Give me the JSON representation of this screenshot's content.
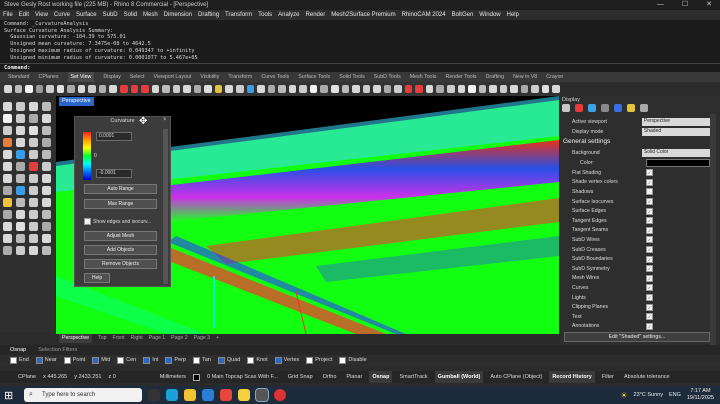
{
  "window": {
    "title": "Steve Gesly Rost working file (225 MB) - Rhino 8 Commercial - [Perspective]",
    "controls": [
      "—",
      "☐",
      "✕"
    ]
  },
  "menu": [
    "File",
    "Edit",
    "View",
    "Curve",
    "Surface",
    "SubD",
    "Solid",
    "Mesh",
    "Dimension",
    "Drafting",
    "Transform",
    "Tools",
    "Analyze",
    "Render",
    "Mesh2Surface Premium",
    "RhinoCAM 2024",
    "BoltGen",
    "Window",
    "Help"
  ],
  "command_history": [
    "Command: _CurvatureAnalysis",
    "Surface Curvature Analysis Summary:",
    "  Gaussian curvature: -104.39 to 575.01",
    "  Unsigned mean curvature: 7.3475e-08 to 4642.5",
    "  Unsigned maximum radius of curvature: 0.049347 to +infinity",
    "  Unsigned minimum radius of curvature: 0.0001077 to 5.467e+05"
  ],
  "command_prompt": "Command:",
  "toolbar_tabs": [
    "Standard",
    "CPlanes",
    "Set View",
    "Display",
    "Select",
    "Viewport Layout",
    "Visibility",
    "Transform",
    "Curve Tools",
    "Surface Tools",
    "Solid Tools",
    "SubD Tools",
    "Mesh Tools",
    "Render Tools",
    "Drafting",
    "New in V8",
    "Crayon"
  ],
  "toolbar_tab_active": "Set View",
  "viewport": {
    "label": "Perspective",
    "tabs": [
      "Perspective",
      "Top",
      "Front",
      "Right",
      "Page 1",
      "Page 2",
      "Page 3",
      "+"
    ],
    "active_tab": "Perspective"
  },
  "curvature_panel": {
    "title": "Curvature",
    "max_value": "0.0001",
    "mid_value": "0",
    "min_value": "-0.0001",
    "auto_range": "Auto Range",
    "max_range": "Max Range",
    "show_edges": "Show edges and isocurv...",
    "adjust_mesh": "Adjust Mesh",
    "add_objects": "Add Objects",
    "remove_objects": "Remove Objects",
    "help": "Help"
  },
  "display_panel": {
    "title": "Display",
    "active_viewport_label": "Active viewport",
    "active_viewport_value": "Perspective",
    "display_mode_label": "Display mode",
    "display_mode_value": "Shaded",
    "section": "General settings",
    "background_label": "Background",
    "background_value": "Solid Color",
    "color_label": "Color:",
    "options": [
      {
        "label": "Flat Shading",
        "checked": true
      },
      {
        "label": "Shade vertex colors",
        "checked": true
      },
      {
        "label": "Shadows",
        "checked": false
      },
      {
        "label": "Surface Isocurves",
        "checked": true
      },
      {
        "label": "Surface Edges",
        "checked": true
      },
      {
        "label": "Tangent Edges",
        "checked": true
      },
      {
        "label": "Tangent Seams",
        "checked": true
      },
      {
        "label": "SubD Wires",
        "checked": true
      },
      {
        "label": "SubD Creases",
        "checked": true
      },
      {
        "label": "SubD Boundaries",
        "checked": true
      },
      {
        "label": "SubD Symmetry",
        "checked": true
      },
      {
        "label": "Mesh Wires",
        "checked": true
      },
      {
        "label": "Curves",
        "checked": true
      },
      {
        "label": "Lights",
        "checked": true
      },
      {
        "label": "Clipping Planes",
        "checked": true
      },
      {
        "label": "Text",
        "checked": true
      },
      {
        "label": "Annotations",
        "checked": true
      }
    ],
    "edit_button": "Edit \"Shaded\" settings..."
  },
  "osnap": {
    "tabs": [
      "Osnap",
      "Selection Filters"
    ],
    "items": [
      {
        "label": "End",
        "on": false
      },
      {
        "label": "Near",
        "on": true
      },
      {
        "label": "Point",
        "on": false
      },
      {
        "label": "Mid",
        "on": true
      },
      {
        "label": "Cen",
        "on": false
      },
      {
        "label": "Int",
        "on": true
      },
      {
        "label": "Perp",
        "on": true
      },
      {
        "label": "Tan",
        "on": false
      },
      {
        "label": "Quad",
        "on": true
      },
      {
        "label": "Knot",
        "on": false
      },
      {
        "label": "Vertex",
        "on": true
      },
      {
        "label": "Project",
        "on": false
      },
      {
        "label": "Disable",
        "on": false
      }
    ]
  },
  "status": {
    "cplane": "CPlane",
    "x": "x 445.265",
    "y": "y 2433.251",
    "z": "z 0",
    "units": "Millimeters",
    "layer": "0 Main Topcap Scas With F...",
    "buttons": [
      "Grid Snap",
      "Ortho",
      "Planar",
      "Osnap",
      "SmartTrack",
      "Gumball (World)",
      "Auto CPlane (Object)",
      "Record History",
      "Filter",
      "Absolute tolerance"
    ],
    "highlighted": [
      "Osnap",
      "Gumball (World)",
      "Record History"
    ]
  },
  "taskbar": {
    "search_placeholder": "Type here to search",
    "weather": "23°C  Sunny",
    "lang": "ENG",
    "time": "7:17 AM",
    "date": "19/11/2025"
  }
}
